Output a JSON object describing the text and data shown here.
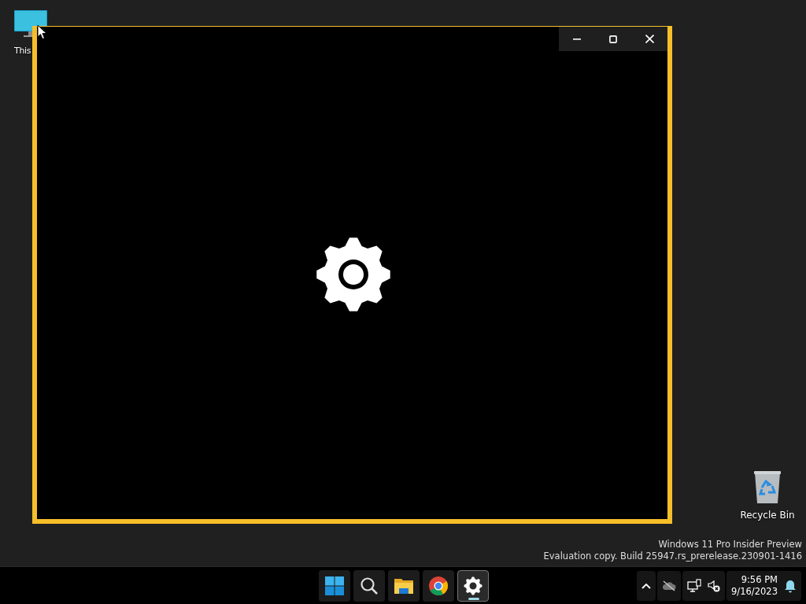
{
  "desktop_icons": [
    {
      "kind": "monitor",
      "label": "This"
    },
    {
      "kind": "recycle-bin",
      "label": "Recycle Bin"
    }
  ],
  "os_notice": [
    "Windows 11 Pro Insider Preview",
    "Evaluation copy. Build 25947.rs_prerelease.230901-1416"
  ],
  "taskbar": {
    "apps": [
      {
        "kind": "start",
        "selected": false
      },
      {
        "kind": "search",
        "selected": false
      },
      {
        "kind": "files",
        "selected": false
      },
      {
        "kind": "browser",
        "selected": false
      },
      {
        "kind": "settings",
        "selected": true
      }
    ],
    "clock": {
      "time": "9:56 PM",
      "date": "9/16/2023"
    }
  }
}
